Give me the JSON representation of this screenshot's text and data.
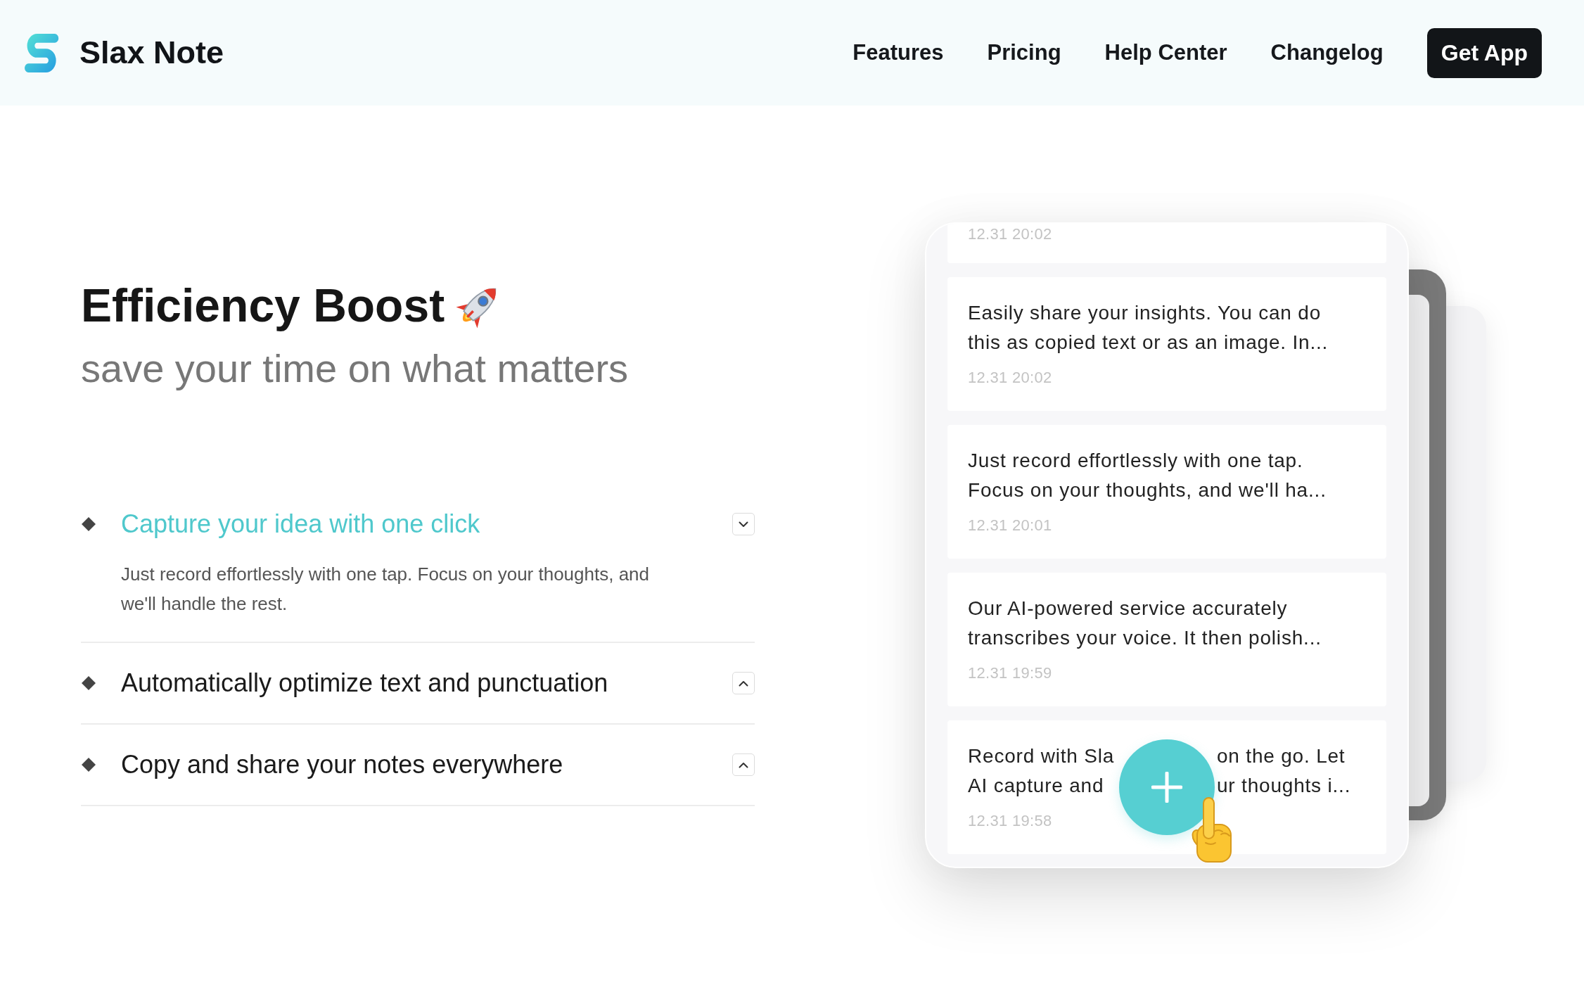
{
  "header": {
    "brand": "Slax Note",
    "nav": [
      {
        "label": "Features"
      },
      {
        "label": "Pricing"
      },
      {
        "label": "Help Center"
      },
      {
        "label": "Changelog"
      }
    ],
    "cta": "Get App"
  },
  "hero": {
    "title": "Efficiency Boost",
    "subtitle": "save your time on what matters"
  },
  "features": [
    {
      "title": "Capture your idea with one click",
      "expanded": true,
      "description": "Just record effortlessly with one tap. Focus on your thoughts, and we'll handle the rest."
    },
    {
      "title": "Automatically optimize text and punctuation",
      "expanded": false
    },
    {
      "title": "Copy and share your notes everywhere",
      "expanded": false
    }
  ],
  "phone": {
    "notes": [
      {
        "kind": "partial",
        "time": "12.31 20:02"
      },
      {
        "kind": "full",
        "text": "Easily share your insights. You can do\nthis as copied text or as an image. In...",
        "time": "12.31 20:02"
      },
      {
        "kind": "full",
        "text": "Just record effortlessly with one tap.\nFocus on your thoughts, and we'll ha...",
        "time": "12.31 20:01"
      },
      {
        "kind": "full",
        "text": "Our AI-powered service accurately\ntranscribes your voice. It then polish...",
        "time": "12.31 19:59"
      },
      {
        "kind": "covered",
        "lines": [
          {
            "before": "Record with Sla",
            "after": "on the go. Let"
          },
          {
            "before": "AI capture and",
            "after": "ur thoughts i..."
          }
        ],
        "time": "12.31 19:58"
      }
    ]
  }
}
